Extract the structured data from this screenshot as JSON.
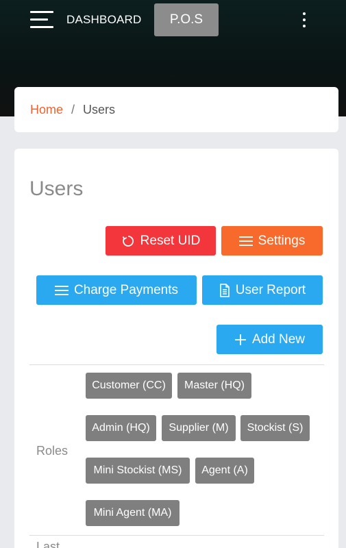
{
  "topbar": {
    "title": "DASHBOARD",
    "pos_label": "P.O.S"
  },
  "breadcrumb": {
    "home": "Home",
    "separator": "/",
    "current": "Users"
  },
  "main": {
    "title": "Users",
    "buttons": {
      "reset_uid": "Reset UID",
      "settings": "Settings",
      "charge_payments": "Charge Payments",
      "user_report": "User Report",
      "add_new": "Add New"
    },
    "roles_label": "Roles",
    "roles": [
      "Customer (CC)",
      "Master (HQ)",
      "Admin (HQ)",
      "Supplier (M)",
      "Stockist (S)",
      "Mini Stockist (MS)",
      "Agent (A)",
      "Mini Agent (MA)"
    ],
    "last_label": "Last"
  },
  "colors": {
    "accent_orange": "#f76a2b",
    "danger_red": "#f3363b",
    "primary_blue": "#2aa9f0",
    "chip_gray": "#7f7f7f",
    "header_dark": "#0d1f1f"
  },
  "icons": {
    "menu": "hamburger-icon",
    "more": "kebab-icon",
    "reset": "refresh-icon",
    "settings": "list-icon",
    "charge": "list-icon",
    "report": "document-icon",
    "add": "plus-icon"
  }
}
